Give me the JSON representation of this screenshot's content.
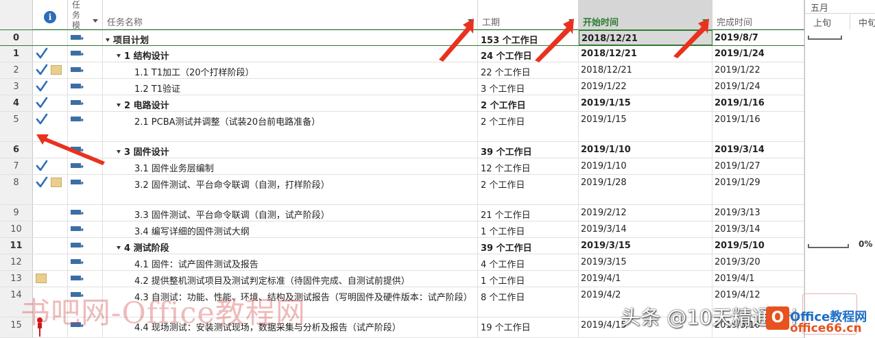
{
  "header": {
    "info_symbol": "i",
    "mode_label": "任务模",
    "name": "任务名称",
    "duration": "工期",
    "start": "开始时间",
    "finish": "完成时间"
  },
  "timescale": {
    "month": "五月",
    "periods": [
      "上旬",
      "中旬"
    ]
  },
  "rows": [
    {
      "id": "0",
      "name": "项目计划",
      "duration": "153 个工作日",
      "start": "2018/12/21",
      "finish": "2019/8/7"
    },
    {
      "id": "1",
      "name": "1 结构设计",
      "duration": "24 个工作日",
      "start": "2018/12/21",
      "finish": "2019/1/24"
    },
    {
      "id": "2",
      "name": "1.1 T1加工（20个打样阶段）",
      "duration": "22 个工作日",
      "start": "2018/12/21",
      "finish": "2019/1/22"
    },
    {
      "id": "3",
      "name": "1.2 T1验证",
      "duration": "3 个工作日",
      "start": "2019/1/22",
      "finish": "2019/1/24"
    },
    {
      "id": "4",
      "name": "2 电路设计",
      "duration": "2 个工作日",
      "start": "2019/1/15",
      "finish": "2019/1/16"
    },
    {
      "id": "5",
      "name": "2.1 PCBA测试并调整（试装20台前电路准备）",
      "duration": "2 个工作日",
      "start": "2019/1/15",
      "finish": "2019/1/16"
    },
    {
      "id": "6",
      "name": "3 固件设计",
      "duration": "39 个工作日",
      "start": "2019/1/10",
      "finish": "2019/3/14"
    },
    {
      "id": "7",
      "name": "3.1 固件业务层编制",
      "duration": "12 个工作日",
      "start": "2019/1/10",
      "finish": "2019/1/27"
    },
    {
      "id": "8",
      "name": "3.2 固件测试、平台命令联调（自测，打样阶段）",
      "duration": "2 个工作日",
      "start": "2019/1/28",
      "finish": "2019/1/29"
    },
    {
      "id": "9",
      "name": "3.3 固件测试、平台命令联调（自测，试产阶段）",
      "duration": "21 个工作日",
      "start": "2019/2/12",
      "finish": "2019/3/13"
    },
    {
      "id": "10",
      "name": "3.4 编写详细的固件测试大纲",
      "duration": "1 个工作日",
      "start": "2019/3/14",
      "finish": "2019/3/14"
    },
    {
      "id": "11",
      "name": "4 测试阶段",
      "duration": "39 个工作日",
      "start": "2019/3/15",
      "finish": "2019/5/10"
    },
    {
      "id": "12",
      "name": "4.1 固件：试产固件测试及报告",
      "duration": "4 个工作日",
      "start": "2019/3/15",
      "finish": "2019/3/20"
    },
    {
      "id": "13",
      "name": "4.2 提供整机测试项目及测试判定标准（待固件完成、自测试前提供）",
      "duration": "1 个工作日",
      "start": "2019/4/1",
      "finish": "2019/4/1"
    },
    {
      "id": "14",
      "name": "4.3 自测试：功能、性能、环境、结构及测试报告（写明固件及硬件版本：试产阶段）",
      "duration": "8 个工作日",
      "start": "2019/4/2",
      "finish": "2019/4/12"
    },
    {
      "id": "15",
      "name": "4.4 现场测试：安装测试现场，数据采集与分析及报告（试产阶段）",
      "duration": "19 个工作日",
      "start": "2019/4/15",
      "finish": "2019/5/10"
    }
  ],
  "gantt": {
    "pct_label": "0%"
  },
  "overlay": {
    "watermark": "书吧网-Office教程网",
    "toutiao": "头条 @10天精通Pri",
    "logo_letter": "O",
    "logo_line1": "Office教程网",
    "logo_line2": "office66.cn"
  }
}
